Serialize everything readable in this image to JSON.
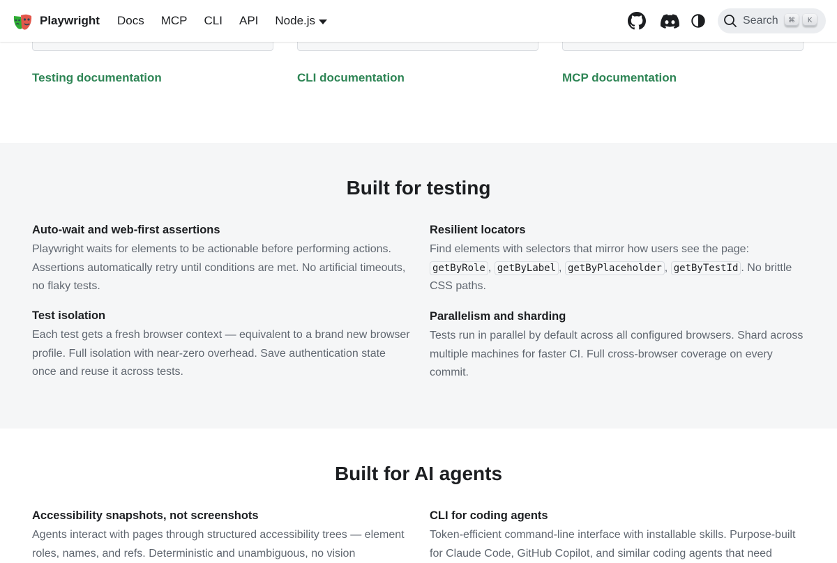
{
  "navbar": {
    "brand": "Playwright",
    "links": [
      "Docs",
      "MCP",
      "CLI",
      "API"
    ],
    "language": "Node.js",
    "search_placeholder": "Search",
    "search_keys": [
      "⌘",
      "K"
    ]
  },
  "top": {
    "links": [
      "Testing documentation",
      "CLI documentation",
      "MCP documentation"
    ]
  },
  "testing": {
    "title": "Built for testing",
    "features": [
      {
        "title": "Auto-wait and web-first assertions",
        "text": "Playwright waits for elements to be actionable before performing actions. Assertions automatically retry until conditions are met. No artificial timeouts, no flaky tests."
      },
      {
        "title": "Resilient locators",
        "intro": "Find elements with selectors that mirror how users see the page:",
        "codes": [
          "getByRole",
          "getByLabel",
          "getByPlaceholder",
          "getByTestId"
        ],
        "outro": "No brittle CSS paths."
      },
      {
        "title": "Test isolation",
        "text": "Each test gets a fresh browser context — equivalent to a brand new browser profile. Full isolation with near-zero overhead. Save authentication state once and reuse it across tests."
      },
      {
        "title": "Parallelism and sharding",
        "text": "Tests run in parallel by default across all configured browsers. Shard across multiple machines for faster CI. Full cross-browser coverage on every commit."
      }
    ]
  },
  "agents": {
    "title": "Built for AI agents",
    "features": [
      {
        "title": "Accessibility snapshots, not screenshots",
        "text": "Agents interact with pages through structured accessibility trees — element roles, names, and refs. Deterministic and unambiguous, no vision"
      },
      {
        "title": "CLI for coding agents",
        "text": "Token-efficient command-line interface with installable skills. Purpose-built for Claude Code, GitHub Copilot, and similar coding agents that need"
      }
    ]
  }
}
